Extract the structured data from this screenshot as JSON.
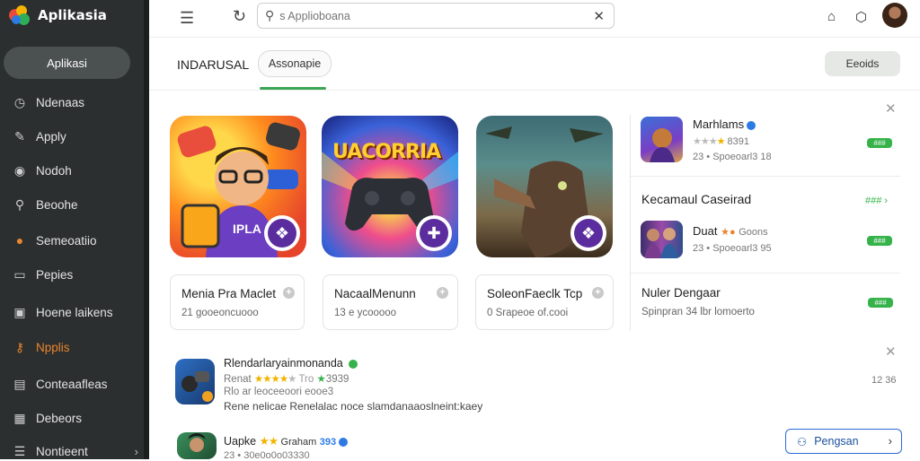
{
  "app": {
    "name": "Aplikasia"
  },
  "sidebar": {
    "button_label": "Aplikasi",
    "items": [
      {
        "label": "Ndenaas",
        "icon": "clock-icon"
      },
      {
        "label": "Apply",
        "icon": "pen-icon"
      },
      {
        "label": "Nodoh",
        "icon": "record-icon"
      },
      {
        "label": "Beoohe",
        "icon": "search-icon"
      },
      {
        "label": "Semeoatiio",
        "icon": "medal-icon"
      },
      {
        "label": "Pepies",
        "icon": "chat-icon"
      },
      {
        "label": "Hoene laikens",
        "icon": "image-icon"
      },
      {
        "label": "Npplis",
        "icon": "key-icon",
        "active": true
      },
      {
        "label": "Conteaafleas",
        "icon": "document-icon"
      },
      {
        "label": "Debeors",
        "icon": "calendar-icon"
      },
      {
        "label": "Nontieent",
        "icon": "list-icon"
      }
    ]
  },
  "topbar": {
    "search_placeholder": "s Applioboana"
  },
  "tabs": {
    "title": "INDARUSAL",
    "pill_label": "Assonapie",
    "right_button": "Eeoids"
  },
  "featured": [
    {
      "name": "Menia Pra Maclet",
      "meta": "21 gooeoncuooo"
    },
    {
      "name": "NacaalMenunn",
      "meta": "13 e ycooooo"
    },
    {
      "name": "SoleonFaeclk Tcp",
      "meta": "0 Srapeoe of.cooi"
    },
    {
      "name": "Nuler Dengaar",
      "meta": "Spinpran 34 lbr lomoerto"
    }
  ],
  "featured_logo_text": "UACORRIA",
  "featured_icon_text": "IPLA",
  "right_panel": {
    "item1": {
      "title": "Marhlams",
      "meta1": "8391",
      "meta2": "23 • Spoeoarl3 18",
      "pill": "###"
    },
    "section_title": "Kecamaul Caseirad",
    "section_link": "###",
    "item2": {
      "title": "Duat",
      "meta1": "Goons",
      "meta2": "23 • Spoeoarl3 95",
      "pill": "###"
    },
    "item3_pill": "###"
  },
  "list": [
    {
      "title": "Rlendarlaryainmonanda",
      "meta1": "Renat",
      "rating": "3939",
      "meta2": "Rlo ar leoceeoori eooe3",
      "desc": "Rene nelicae Renelalac noce slamdanaaoslneint:kaey",
      "time": "12 36"
    },
    {
      "title": "Uapke",
      "meta1": "Graham",
      "rating": "393",
      "meta2": "23 • 30e0o0o03330"
    }
  ],
  "list_button": "Pengsan"
}
